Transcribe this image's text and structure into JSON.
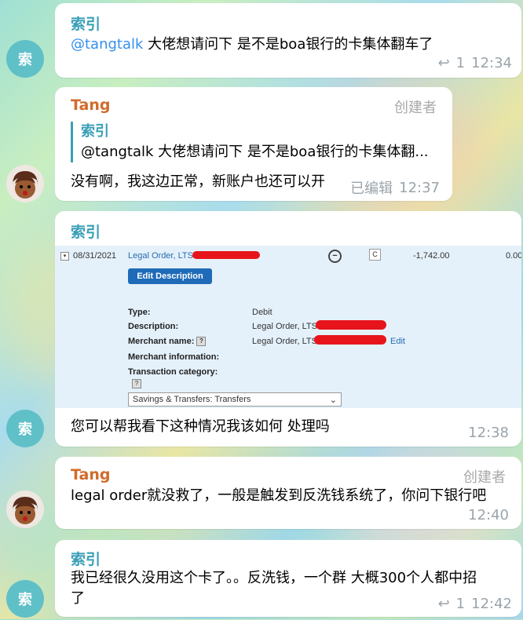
{
  "messages": [
    {
      "sender": "索引",
      "mention": "@tangtalk",
      "text": " 大佬想请问下 是不是boa银行的卡集体翻车了",
      "replies": "1",
      "time": "12:34"
    },
    {
      "sender": "Tang",
      "role": "创建者",
      "quote_sender": "索引",
      "quote_text": "@tangtalk 大佬想请问下 是不是boa银行的卡集体翻...",
      "text": "没有啊，我这边正常，新账户也还可以开",
      "edited": "已编辑",
      "time": "12:37"
    },
    {
      "sender": "索引",
      "text": "您可以帮我看下这种情况我该如何 处理吗",
      "time": "12:38",
      "screenshot": {
        "date": "08/31/2021",
        "desc_link": "Legal Order, LTS",
        "amount": "-1,742.00",
        "balance": "0.00",
        "edit_button": "Edit Description",
        "type_label": "Type:",
        "type_value": "Debit",
        "description_label": "Description:",
        "description_value": "Legal Order, LTS",
        "merchant_label": "Merchant name:",
        "merchant_value": "Legal Order, LTS",
        "merchant_edit": "Edit",
        "merchant_info_label": "Merchant information:",
        "category_label": "Transaction category:",
        "category_select": "Savings & Transfers: Transfers",
        "c_badge": "C"
      }
    },
    {
      "sender": "Tang",
      "role": "创建者",
      "text": "legal order就没救了，一般是触发到反洗钱系统了，你问下银行吧",
      "time": "12:40"
    },
    {
      "sender": "索引",
      "text_line1": "我已经很久没用这个卡了。。反洗钱，一个群 大概300个人都中招",
      "text_line2": "了",
      "replies": "1",
      "time": "12:42"
    }
  ],
  "avatars": {
    "suo_label": "索"
  }
}
